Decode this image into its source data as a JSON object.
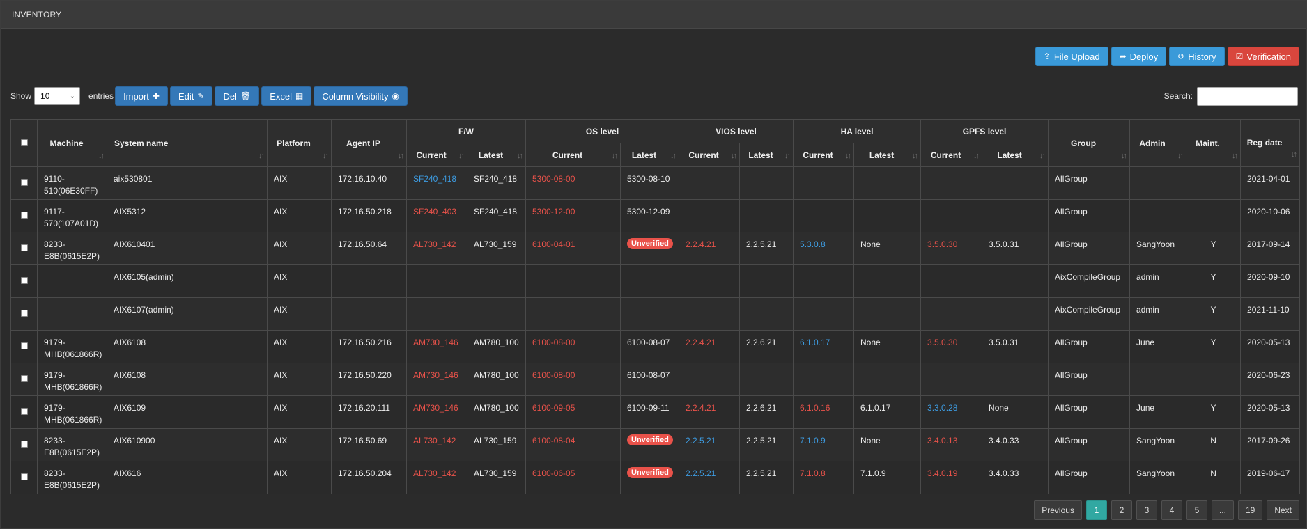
{
  "window_title": "INVENTORY",
  "top_actions": [
    {
      "label": "File Upload",
      "icon": "upload-icon",
      "glyph": "⇪"
    },
    {
      "label": "Deploy",
      "icon": "share-icon",
      "glyph": "➦"
    },
    {
      "label": "History",
      "icon": "history-icon",
      "glyph": "↺"
    },
    {
      "label": "Verification",
      "icon": "check-square-icon",
      "glyph": "☑"
    }
  ],
  "controls": {
    "show_label": "Show",
    "entries_value": "10",
    "entries_label": "entries",
    "import_label": "Import",
    "edit_label": "Edit",
    "del_label": "Del",
    "excel_label": "Excel",
    "column_visibility_label": "Column Visibility",
    "search_label": "Search:",
    "search_value": ""
  },
  "columns": {
    "machine": "Machine",
    "system_name": "System name",
    "platform": "Platform",
    "agent_ip": "Agent IP",
    "fw": "F/W",
    "os_level": "OS level",
    "vios_level": "VIOS level",
    "ha_level": "HA level",
    "gpfs_level": "GPFS level",
    "current": "Current",
    "latest": "Latest",
    "group": "Group",
    "admin": "Admin",
    "maint": "Maint.",
    "reg_date": "Reg date"
  },
  "rows": [
    {
      "machine": "9110-510(06E30FF)",
      "system_name": "aix530801",
      "platform": "AIX",
      "agent_ip": "172.16.10.40",
      "fw_cur": "SF240_418",
      "fw_cur_color": "blue",
      "fw_lat": "SF240_418",
      "os_cur": "5300-08-00",
      "os_cur_color": "red",
      "os_lat": "5300-08-10",
      "vios_cur": "",
      "vios_cur_color": "",
      "vios_lat": "",
      "ha_cur": "",
      "ha_cur_color": "",
      "ha_lat": "",
      "gpfs_cur": "",
      "gpfs_cur_color": "",
      "gpfs_lat": "",
      "group": "AllGroup",
      "admin": "",
      "maint": "",
      "reg_date": "2021-04-01"
    },
    {
      "machine": "9117-570(107A01D)",
      "system_name": "AIX5312",
      "platform": "AIX",
      "agent_ip": "172.16.50.218",
      "fw_cur": "SF240_403",
      "fw_cur_color": "red",
      "fw_lat": "SF240_418",
      "os_cur": "5300-12-00",
      "os_cur_color": "red",
      "os_lat": "5300-12-09",
      "vios_cur": "",
      "vios_cur_color": "",
      "vios_lat": "",
      "ha_cur": "",
      "ha_cur_color": "",
      "ha_lat": "",
      "gpfs_cur": "",
      "gpfs_cur_color": "",
      "gpfs_lat": "",
      "group": "AllGroup",
      "admin": "",
      "maint": "",
      "reg_date": "2020-10-06"
    },
    {
      "machine": "8233-E8B(0615E2P)",
      "system_name": "AIX610401",
      "platform": "AIX",
      "agent_ip": "172.16.50.64",
      "fw_cur": "AL730_142",
      "fw_cur_color": "red",
      "fw_lat": "AL730_159",
      "os_cur": "6100-04-01",
      "os_cur_color": "red",
      "os_lat": "Unverified",
      "vios_cur": "2.2.4.21",
      "vios_cur_color": "red",
      "vios_lat": "2.2.5.21",
      "ha_cur": "5.3.0.8",
      "ha_cur_color": "blue",
      "ha_lat": "None",
      "gpfs_cur": "3.5.0.30",
      "gpfs_cur_color": "red",
      "gpfs_lat": "3.5.0.31",
      "group": "AllGroup",
      "admin": "SangYoon",
      "maint": "Y",
      "reg_date": "2017-09-14"
    },
    {
      "machine": "",
      "system_name": "AIX6105(admin)",
      "platform": "AIX",
      "agent_ip": "",
      "fw_cur": "",
      "fw_cur_color": "",
      "fw_lat": "",
      "os_cur": "",
      "os_cur_color": "",
      "os_lat": "",
      "vios_cur": "",
      "vios_cur_color": "",
      "vios_lat": "",
      "ha_cur": "",
      "ha_cur_color": "",
      "ha_lat": "",
      "gpfs_cur": "",
      "gpfs_cur_color": "",
      "gpfs_lat": "",
      "group": "AixCompileGroup",
      "admin": "admin",
      "maint": "Y",
      "reg_date": "2020-09-10"
    },
    {
      "machine": "",
      "system_name": "AIX6107(admin)",
      "platform": "AIX",
      "agent_ip": "",
      "fw_cur": "",
      "fw_cur_color": "",
      "fw_lat": "",
      "os_cur": "",
      "os_cur_color": "",
      "os_lat": "",
      "vios_cur": "",
      "vios_cur_color": "",
      "vios_lat": "",
      "ha_cur": "",
      "ha_cur_color": "",
      "ha_lat": "",
      "gpfs_cur": "",
      "gpfs_cur_color": "",
      "gpfs_lat": "",
      "group": "AixCompileGroup",
      "admin": "admin",
      "maint": "Y",
      "reg_date": "2021-11-10"
    },
    {
      "machine": "9179-MHB(061866R)",
      "system_name": "AIX6108",
      "platform": "AIX",
      "agent_ip": "172.16.50.216",
      "fw_cur": "AM730_146",
      "fw_cur_color": "red",
      "fw_lat": "AM780_100",
      "os_cur": "6100-08-00",
      "os_cur_color": "red",
      "os_lat": "6100-08-07",
      "vios_cur": "2.2.4.21",
      "vios_cur_color": "red",
      "vios_lat": "2.2.6.21",
      "ha_cur": "6.1.0.17",
      "ha_cur_color": "blue",
      "ha_lat": "None",
      "gpfs_cur": "3.5.0.30",
      "gpfs_cur_color": "red",
      "gpfs_lat": "3.5.0.31",
      "group": "AllGroup",
      "admin": "June",
      "maint": "Y",
      "reg_date": "2020-05-13"
    },
    {
      "machine": "9179-MHB(061866R)",
      "system_name": "AIX6108",
      "platform": "AIX",
      "agent_ip": "172.16.50.220",
      "fw_cur": "AM730_146",
      "fw_cur_color": "red",
      "fw_lat": "AM780_100",
      "os_cur": "6100-08-00",
      "os_cur_color": "red",
      "os_lat": "6100-08-07",
      "vios_cur": "",
      "vios_cur_color": "",
      "vios_lat": "",
      "ha_cur": "",
      "ha_cur_color": "",
      "ha_lat": "",
      "gpfs_cur": "",
      "gpfs_cur_color": "",
      "gpfs_lat": "",
      "group": "AllGroup",
      "admin": "",
      "maint": "",
      "reg_date": "2020-06-23"
    },
    {
      "machine": "9179-MHB(061866R)",
      "system_name": "AIX6109",
      "platform": "AIX",
      "agent_ip": "172.16.20.111",
      "fw_cur": "AM730_146",
      "fw_cur_color": "red",
      "fw_lat": "AM780_100",
      "os_cur": "6100-09-05",
      "os_cur_color": "red",
      "os_lat": "6100-09-11",
      "vios_cur": "2.2.4.21",
      "vios_cur_color": "red",
      "vios_lat": "2.2.6.21",
      "ha_cur": "6.1.0.16",
      "ha_cur_color": "red",
      "ha_lat": "6.1.0.17",
      "gpfs_cur": "3.3.0.28",
      "gpfs_cur_color": "blue",
      "gpfs_lat": "None",
      "group": "AllGroup",
      "admin": "June",
      "maint": "Y",
      "reg_date": "2020-05-13"
    },
    {
      "machine": "8233-E8B(0615E2P)",
      "system_name": "AIX610900",
      "platform": "AIX",
      "agent_ip": "172.16.50.69",
      "fw_cur": "AL730_142",
      "fw_cur_color": "red",
      "fw_lat": "AL730_159",
      "os_cur": "6100-08-04",
      "os_cur_color": "red",
      "os_lat": "Unverified",
      "vios_cur": "2.2.5.21",
      "vios_cur_color": "blue",
      "vios_lat": "2.2.5.21",
      "ha_cur": "7.1.0.9",
      "ha_cur_color": "blue",
      "ha_lat": "None",
      "gpfs_cur": "3.4.0.13",
      "gpfs_cur_color": "red",
      "gpfs_lat": "3.4.0.33",
      "group": "AllGroup",
      "admin": "SangYoon",
      "maint": "N",
      "reg_date": "2017-09-26"
    },
    {
      "machine": "8233-E8B(0615E2P)",
      "system_name": "AIX616",
      "platform": "AIX",
      "agent_ip": "172.16.50.204",
      "fw_cur": "AL730_142",
      "fw_cur_color": "red",
      "fw_lat": "AL730_159",
      "os_cur": "6100-06-05",
      "os_cur_color": "red",
      "os_lat": "Unverified",
      "vios_cur": "2.2.5.21",
      "vios_cur_color": "blue",
      "vios_lat": "2.2.5.21",
      "ha_cur": "7.1.0.8",
      "ha_cur_color": "red",
      "ha_lat": "7.1.0.9",
      "gpfs_cur": "3.4.0.19",
      "gpfs_cur_color": "red",
      "gpfs_lat": "3.4.0.33",
      "group": "AllGroup",
      "admin": "SangYoon",
      "maint": "N",
      "reg_date": "2019-06-17"
    }
  ],
  "pagination": {
    "previous": "Previous",
    "pages": [
      "1",
      "2",
      "3",
      "4",
      "5",
      "...",
      "19"
    ],
    "active": "1",
    "next": "Next"
  },
  "colors": {
    "red": "#e9524a",
    "blue": "#3d9be0",
    "active_page": "#31a8a2"
  }
}
